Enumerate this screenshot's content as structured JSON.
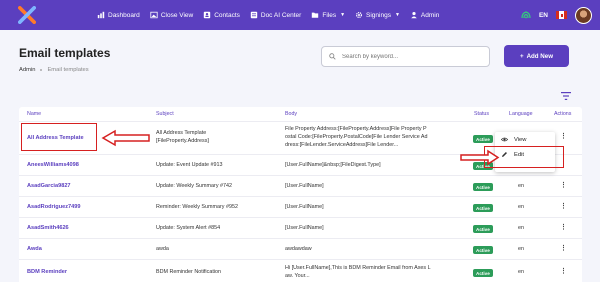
{
  "nav": {
    "items": [
      {
        "label": "Dashboard",
        "icon": "chart-icon"
      },
      {
        "label": "Close View",
        "icon": "image-icon"
      },
      {
        "label": "Contacts",
        "icon": "contacts-icon"
      },
      {
        "label": "Doc AI Center",
        "icon": "doc-icon"
      },
      {
        "label": "Files",
        "icon": "folder-icon",
        "dropdown": true
      },
      {
        "label": "Signings",
        "icon": "gear-icon",
        "dropdown": true
      },
      {
        "label": "Admin",
        "icon": "person-icon"
      }
    ],
    "language": "EN"
  },
  "page": {
    "title": "Email templates",
    "breadcrumb": [
      "Admin",
      "Email templates"
    ],
    "search_placeholder": "Search by keyword...",
    "add_button": "Add New"
  },
  "table": {
    "headers": {
      "name": "Name",
      "subject": "Subject",
      "body": "Body",
      "status": "Status",
      "language": "Language",
      "actions": "Actions"
    },
    "rows": [
      {
        "name": "All Address Template",
        "subject_1": "All Address Template",
        "subject_2": "[FileProperty.Address]",
        "body_1": "File Property Address:[FileProperty.Address]File Property P",
        "body_2": "ostal Code:[FileProperty.PostalCode]File Lender Service Ad",
        "body_3": "dress:[FileLender.ServiceAddress]File Lender...",
        "status": "Active",
        "language": ""
      },
      {
        "name": "AneesWilliams4098",
        "subject_1": "Update: Event Update #913",
        "body_1": "[User.FullName]&nbsp;[FileDigest.Type]",
        "status": "Active",
        "language": "en"
      },
      {
        "name": "AsadGarcia9827",
        "subject_1": "Update: Weekly Summary #742",
        "body_1": "[User.FullName]",
        "status": "Active",
        "language": "en"
      },
      {
        "name": "AsadRodriguez7499",
        "subject_1": "Reminder: Weekly Summary #952",
        "body_1": "[User.FullName]",
        "status": "Active",
        "language": "en"
      },
      {
        "name": "AsadSmith4626",
        "subject_1": "Update: System Alert #854",
        "body_1": "[User.FullName]",
        "status": "Active",
        "language": "en"
      },
      {
        "name": "Awda",
        "subject_1": "awda",
        "body_1": "awdawdaw",
        "status": "Active",
        "language": "en"
      },
      {
        "name": "BDM Reminder",
        "subject_1": "BDM Reminder Notification",
        "body_1": "Hi [User.FullName],This is BDM Reminder Email from Axes L",
        "body_2": "aw. Your...",
        "status": "Active",
        "language": "en"
      }
    ]
  },
  "dropdown": {
    "view": "View",
    "edit": "Edit"
  },
  "colors": {
    "brand": "#5b3fbf",
    "active_badge": "#2c9c59",
    "annotation": "#d62020"
  }
}
